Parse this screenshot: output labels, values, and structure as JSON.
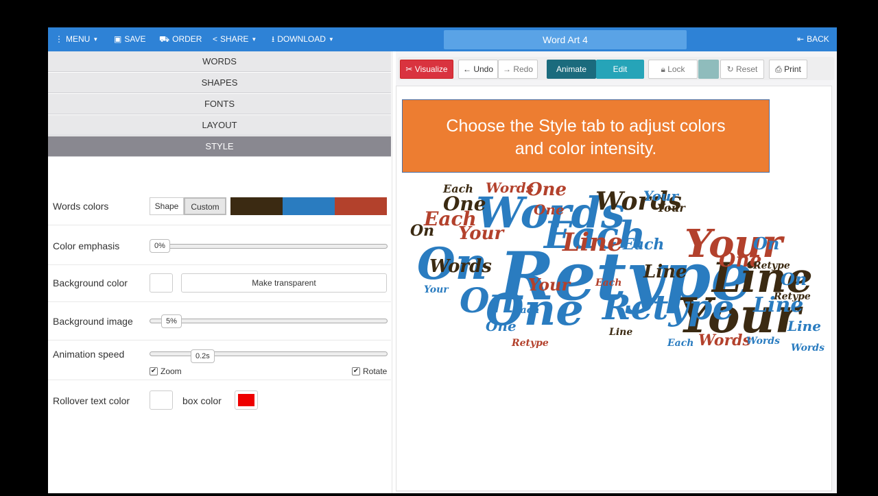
{
  "topbar": {
    "menu": "MENU",
    "save": "SAVE",
    "order": "ORDER",
    "share": "SHARE",
    "download": "DOWNLOAD",
    "title": "Word Art 4",
    "back": "BACK"
  },
  "accordion": [
    "WORDS",
    "SHAPES",
    "FONTS",
    "LAYOUT",
    "STYLE"
  ],
  "style": {
    "words_colors_label": "Words colors",
    "shape_btn": "Shape",
    "custom_btn": "Custom",
    "palette": [
      "#3b2a12",
      "#2a7cc0",
      "#b3412c"
    ],
    "color_emphasis_label": "Color emphasis",
    "color_emphasis_value": "0%",
    "background_color_label": "Background color",
    "make_transparent": "Make transparent",
    "background_image_label": "Background image",
    "background_image_value": "5%",
    "animation_speed_label": "Animation speed",
    "animation_speed_value": "0.2s",
    "zoom_label": "Zoom",
    "rotate_label": "Rotate",
    "rollover_label": "Rollover text color",
    "box_color_label": "box color",
    "box_color": "#ee0000"
  },
  "toolbar": {
    "visualize": "Visualize",
    "undo": "Undo",
    "redo": "Redo",
    "animate": "Animate",
    "edit": "Edit",
    "lock": "Lock",
    "reset": "Reset",
    "print": "Print",
    "lock_color": "#8fbcbc"
  },
  "callout": {
    "line1": "Choose the Style tab to adjust colors",
    "line2": "and color intensity."
  },
  "cloud_words": [
    {
      "t": "Retype",
      "c": "#2a7cc0"
    },
    {
      "t": "Words",
      "c": "#2a7cc0"
    },
    {
      "t": "Each",
      "c": "#2a7cc0"
    },
    {
      "t": "On",
      "c": "#2a7cc0"
    },
    {
      "t": "Your",
      "c": "#b3412c"
    },
    {
      "t": "Your",
      "c": "#3b2a12"
    },
    {
      "t": "Line",
      "c": "#3b2a12"
    },
    {
      "t": "One",
      "c": "#2a7cc0"
    },
    {
      "t": "On",
      "c": "#2a7cc0"
    },
    {
      "t": "Retype",
      "c": "#2a7cc0"
    },
    {
      "t": "Words",
      "c": "#3b2a12"
    },
    {
      "t": "One",
      "c": "#3b2a12"
    },
    {
      "t": "Each",
      "c": "#b3412c"
    },
    {
      "t": "Line",
      "c": "#b3412c"
    },
    {
      "t": "One",
      "c": "#b3412c"
    },
    {
      "t": "Words",
      "c": "#3b2a12"
    },
    {
      "t": "On",
      "c": "#2a7cc0"
    },
    {
      "t": "Your",
      "c": "#b3412c"
    },
    {
      "t": "Each",
      "c": "#2a7cc0"
    },
    {
      "t": "Line",
      "c": "#3b2a12"
    },
    {
      "t": "Words",
      "c": "#b3412c"
    },
    {
      "t": "One",
      "c": "#b3412c"
    },
    {
      "t": "Each",
      "c": "#3b2a12"
    },
    {
      "t": "Your",
      "c": "#2a7cc0"
    },
    {
      "t": "On",
      "c": "#2a7cc0"
    },
    {
      "t": "Retype",
      "c": "#3b2a12"
    },
    {
      "t": "Retype",
      "c": "#b3412c"
    },
    {
      "t": "Line",
      "c": "#3b2a12"
    },
    {
      "t": "Each",
      "c": "#2a7cc0"
    },
    {
      "t": "Words",
      "c": "#b3412c"
    },
    {
      "t": "Words",
      "c": "#2a7cc0"
    },
    {
      "t": "One",
      "c": "#2a7cc0"
    },
    {
      "t": "Your",
      "c": "#b3412c"
    },
    {
      "t": "Each",
      "c": "#2a7cc0"
    },
    {
      "t": "Line",
      "c": "#2a7cc0"
    },
    {
      "t": "On",
      "c": "#3b2a12"
    },
    {
      "t": "Your",
      "c": "#2a7cc0"
    },
    {
      "t": "One",
      "c": "#b3412c"
    },
    {
      "t": "Each",
      "c": "#b3412c"
    },
    {
      "t": "Retype",
      "c": "#3b2a12"
    },
    {
      "t": "Your",
      "c": "#3b2a12"
    },
    {
      "t": "Line",
      "c": "#2a7cc0"
    },
    {
      "t": "Words",
      "c": "#2a7cc0"
    }
  ]
}
